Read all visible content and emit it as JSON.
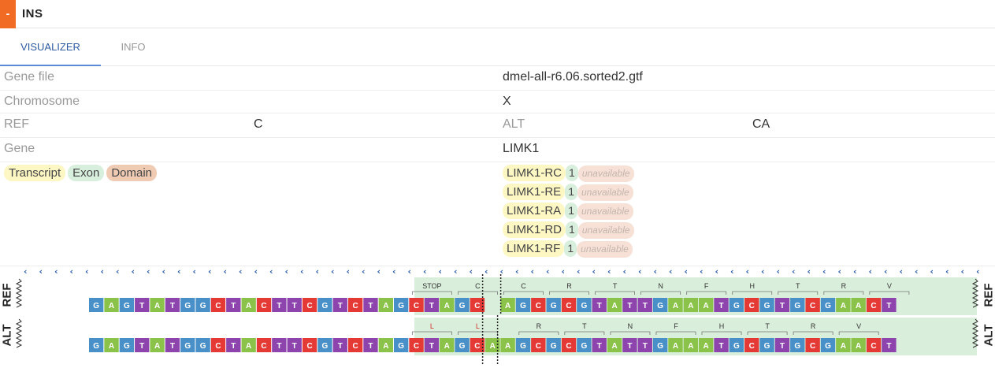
{
  "header": {
    "badge": "-",
    "title": "INS"
  },
  "tabs": [
    {
      "label": "VISUALIZER",
      "active": true
    },
    {
      "label": "INFO",
      "active": false
    }
  ],
  "fields": {
    "gene_file": {
      "label": "Gene file",
      "value": "dmel-all-r6.06.sorted2.gtf"
    },
    "chromosome": {
      "label": "Chromosome",
      "value": "X"
    },
    "ref": {
      "label": "REF",
      "value": "C"
    },
    "alt": {
      "label": "ALT",
      "value": "CA"
    },
    "gene": {
      "label": "Gene",
      "value": "LIMK1"
    }
  },
  "legend": {
    "transcript": "Transcript",
    "exon": "Exon",
    "domain": "Domain"
  },
  "transcripts": [
    {
      "name": "LIMK1-RC",
      "exon": "1",
      "domain": "unavailable"
    },
    {
      "name": "LIMK1-RE",
      "exon": "1",
      "domain": "unavailable"
    },
    {
      "name": "LIMK1-RA",
      "exon": "1",
      "domain": "unavailable"
    },
    {
      "name": "LIMK1-RD",
      "exon": "1",
      "domain": "unavailable"
    },
    {
      "name": "LIMK1-RF",
      "exon": "1",
      "domain": "unavailable"
    }
  ],
  "visualizer": {
    "ref_label": "REF",
    "alt_label": "ALT",
    "ref_seq": "GAGTATGGCTACTTCGTCTAGCTAGC-AGCGCGTATTGAAATGCGTGCGAACT",
    "alt_seq": "GAGTATGGCTACTTCGTCTAGCTAGCAAGCGCGTATTGAAATGCGTGCGAACT",
    "ref_codons": [
      "STOP",
      "C",
      "C",
      "R",
      "T",
      "N",
      "F",
      "H",
      "T",
      "R",
      "V"
    ],
    "alt_codons": [
      "L",
      "L",
      "R",
      "T",
      "N",
      "F",
      "H",
      "T",
      "R",
      "V"
    ],
    "colors": {
      "A": "#8bc34a",
      "G": "#4a90c8",
      "T": "#8e44ad",
      "C": "#e53935",
      "exon_bg": "#d9eedb",
      "arrow": "#2a5caa"
    }
  }
}
